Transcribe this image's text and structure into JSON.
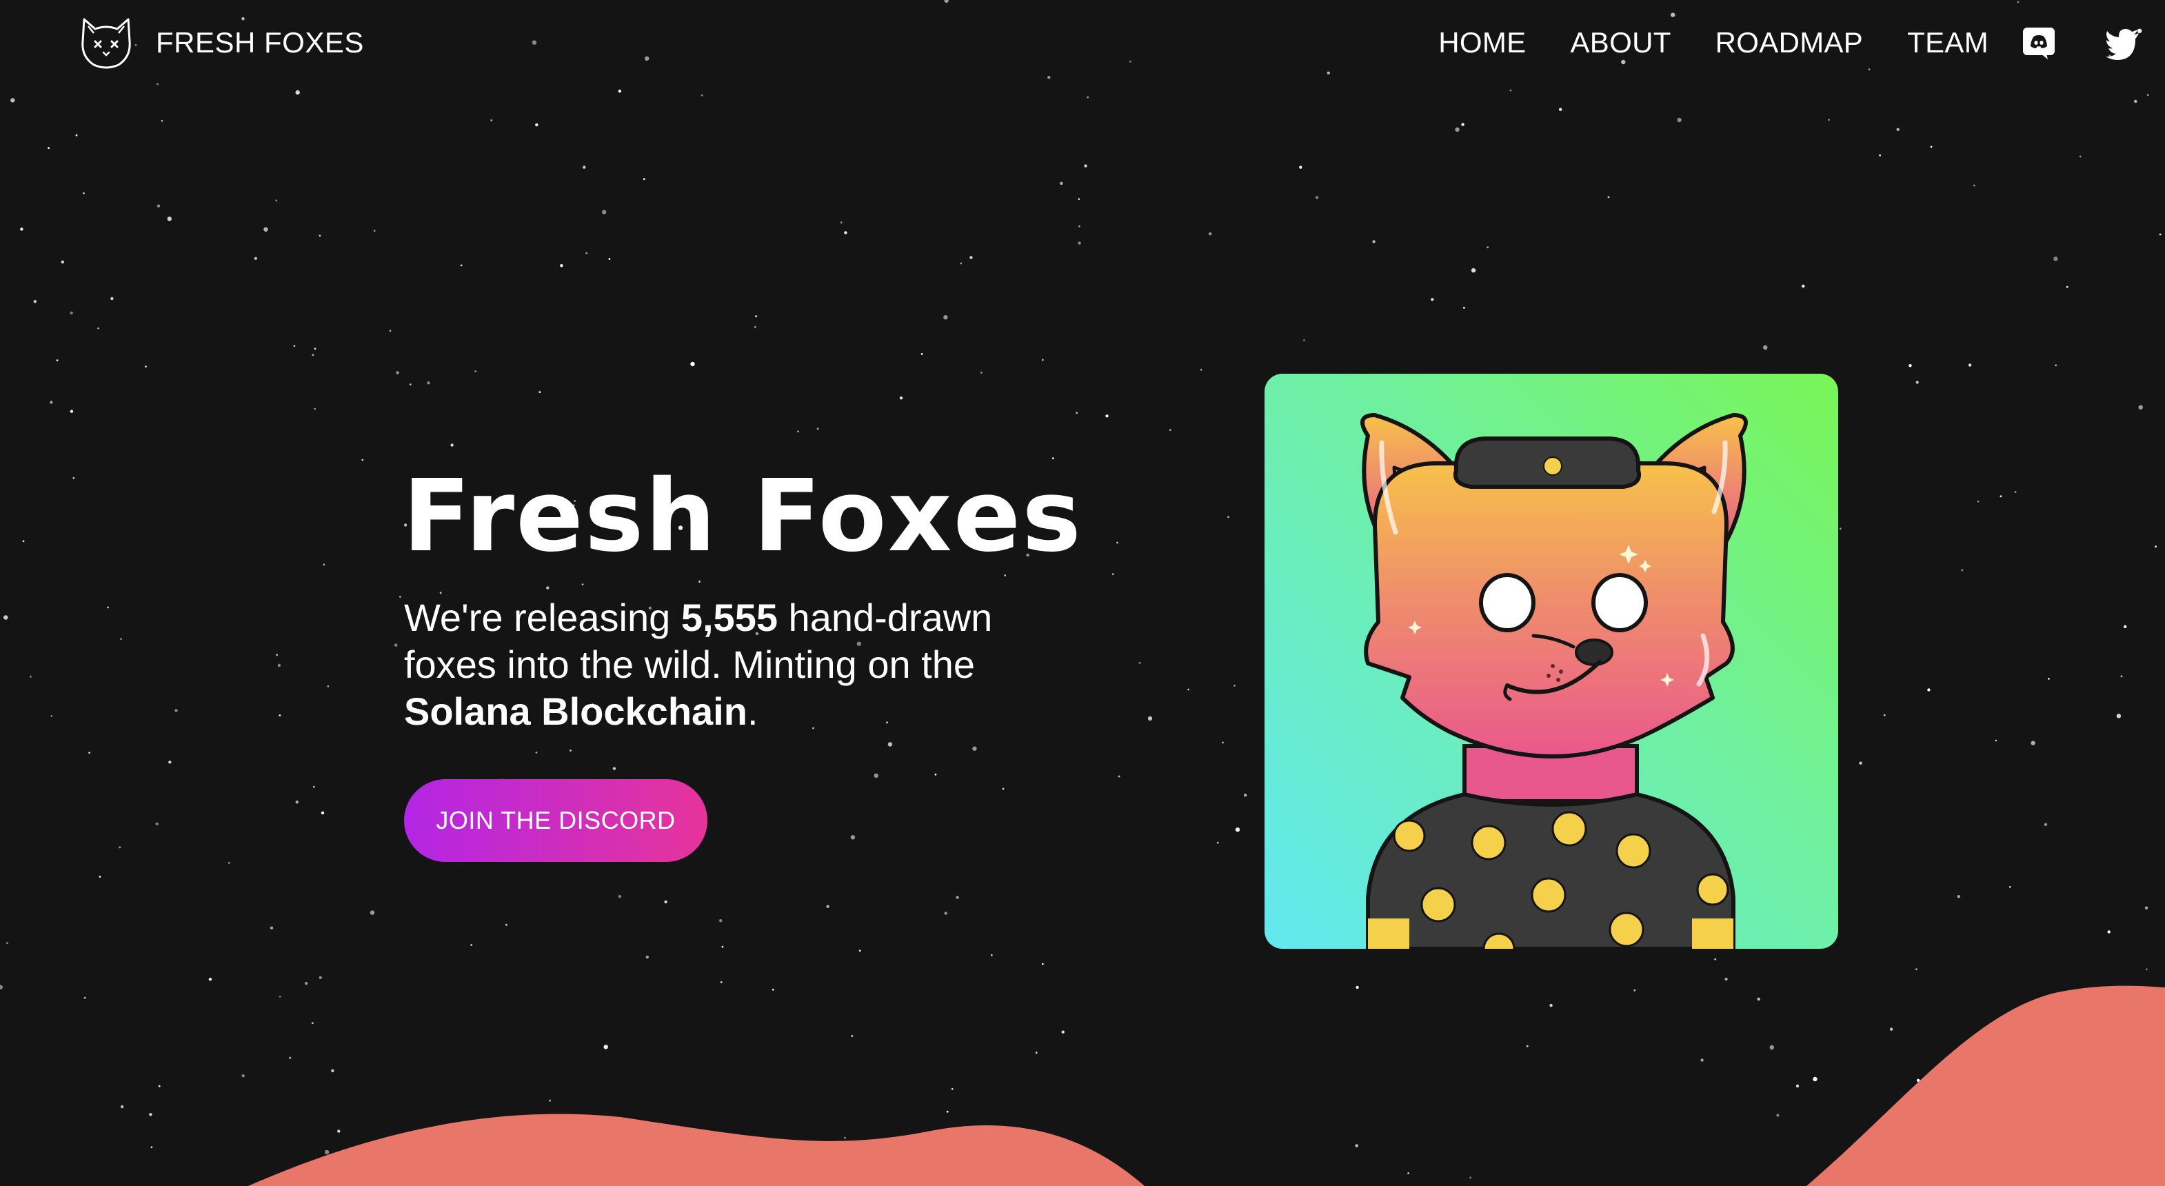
{
  "header": {
    "brand": {
      "logo_icon": "fox-head-icon",
      "name": "FRESH FOXES"
    },
    "nav": [
      {
        "label": "HOME"
      },
      {
        "label": "ABOUT"
      },
      {
        "label": "ROADMAP"
      },
      {
        "label": "TEAM"
      }
    ],
    "social": [
      {
        "icon": "discord-icon"
      },
      {
        "icon": "twitter-icon"
      }
    ]
  },
  "hero": {
    "title": "Fresh Foxes",
    "description": {
      "part1": "We're releasing ",
      "count": "5,555",
      "part2": " hand-drawn foxes into the wild. Minting on the ",
      "chain": "Solana Blockchain",
      "part3": "."
    },
    "cta_label": "JOIN THE DISCORD",
    "image_alt_icon": "fox-nft-illustration"
  },
  "colors": {
    "background": "#141414",
    "hill": "#e8776a",
    "cta_gradient_start": "#b326e6",
    "cta_gradient_end": "#e6349a",
    "card_gradient": [
      "#78f556",
      "#6ff0a2",
      "#61e8f0"
    ]
  }
}
